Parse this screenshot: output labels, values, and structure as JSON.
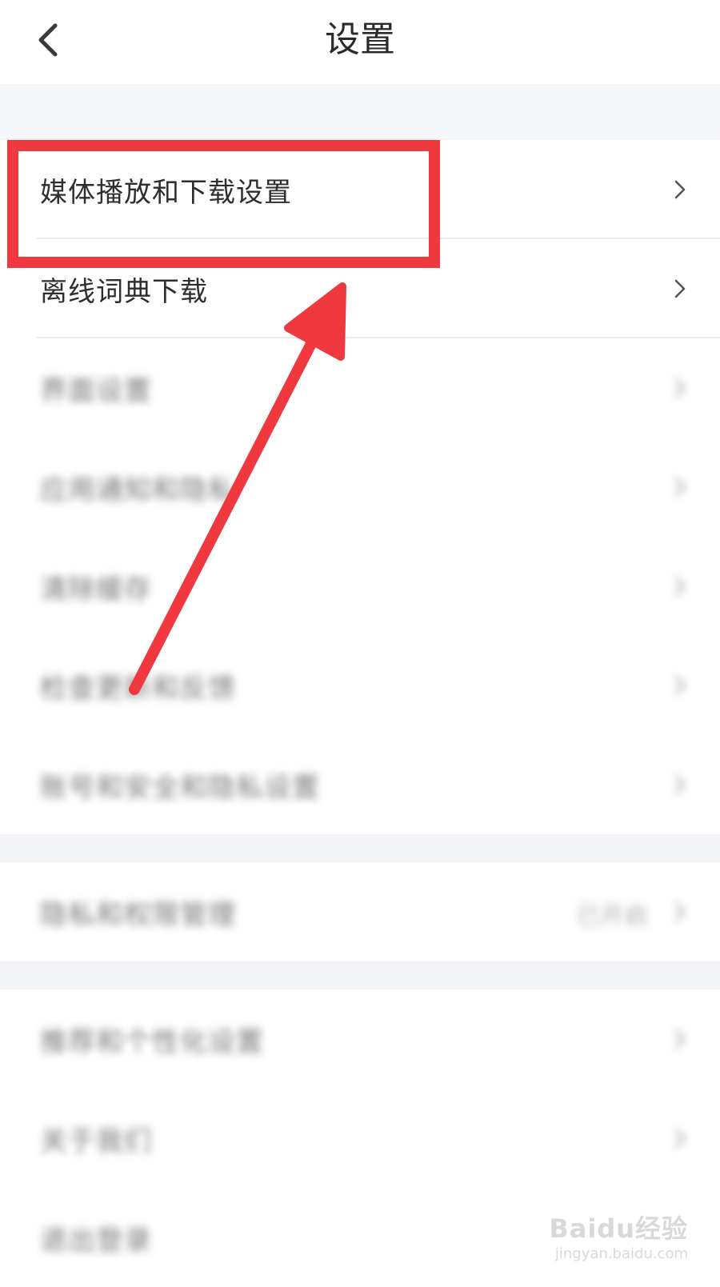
{
  "header": {
    "title": "设置",
    "back_icon": "chevron-left-icon"
  },
  "section1": {
    "items": [
      {
        "label": "媒体播放和下载设置"
      },
      {
        "label": "离线词典下载"
      },
      {
        "label": "界面设置"
      },
      {
        "label": "应用通知和隐私"
      },
      {
        "label": "清除缓存"
      },
      {
        "label": "检查更新和反馈"
      },
      {
        "label": "账号和安全和隐私设置"
      }
    ]
  },
  "section2": {
    "items": [
      {
        "label": "隐私和权限管理",
        "value": "已开启"
      }
    ]
  },
  "section3": {
    "items": [
      {
        "label": "推荐和个性化设置"
      },
      {
        "label": "关于我们"
      },
      {
        "label": "退出登录"
      }
    ]
  },
  "annotation": {
    "box_color": "#f0393f",
    "arrow_color": "#f0393f"
  },
  "watermark": {
    "top": "Baidu经验",
    "bottom": "jingyan.baidu.com"
  }
}
